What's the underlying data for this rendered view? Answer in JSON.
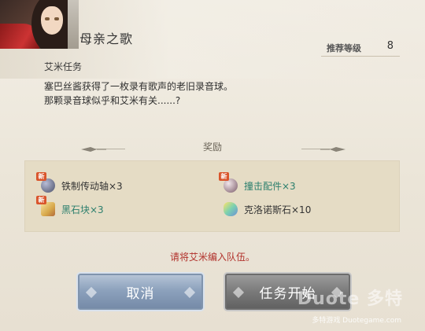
{
  "quest": {
    "title": "母亲之歌",
    "level_label": "推荐等级",
    "level_value": "8",
    "subtitle": "艾米任务",
    "description_line1": "塞巴丝酱获得了一枚录有歌声的老旧录音球。",
    "description_line2": "那颗录音球似乎和艾米有关......?"
  },
  "rewards": {
    "section_label": "奖励",
    "new_badge": "新",
    "items": [
      {
        "label": "铁制传动轴×3",
        "is_new": true,
        "highlight": false,
        "icon": "gear-shaft-icon",
        "color": "#6a6f86"
      },
      {
        "label": "撞击配件×3",
        "is_new": true,
        "highlight": true,
        "icon": "impact-part-icon",
        "color": "#8a6a78"
      },
      {
        "label": "黑石块×3",
        "is_new": true,
        "highlight": true,
        "icon": "black-stone-icon",
        "color": "#e8c56a"
      },
      {
        "label": "克洛诺斯石×10",
        "is_new": false,
        "highlight": false,
        "icon": "chronos-stone-icon",
        "color": "#7bc0a8"
      }
    ]
  },
  "footer": {
    "notice": "请将艾米编入队伍。",
    "cancel_label": "取消",
    "start_label": "任务开始"
  },
  "watermark": {
    "logo": "Duote 多特",
    "text": "多特游戏 Duotegame.com"
  },
  "colors": {
    "accent_text": "#2c7f6d",
    "notice_red": "#b2322c",
    "new_badge": "#d9542b"
  }
}
